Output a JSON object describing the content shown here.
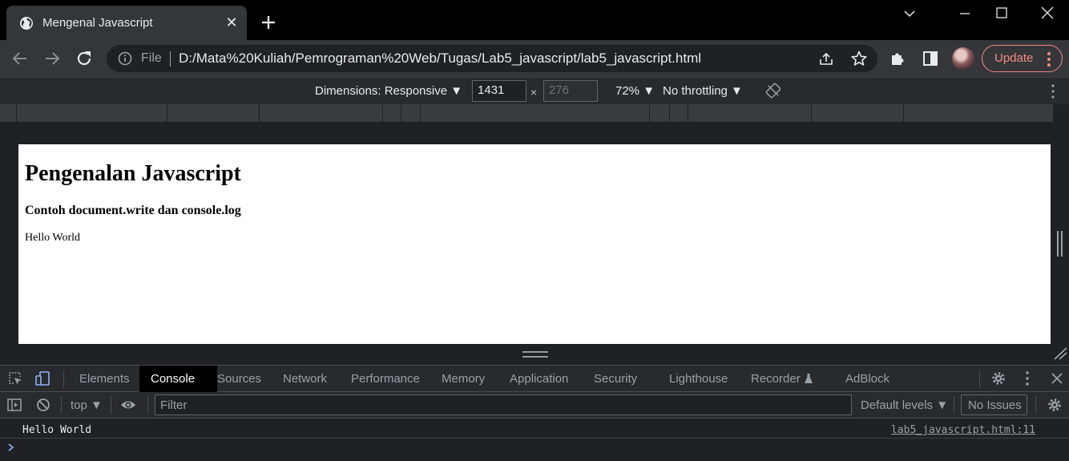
{
  "browser": {
    "tab_title": "Mengenal Javascript",
    "tab_favicon": "globe-icon",
    "new_tab_symbol": "+",
    "close_symbol": "✕",
    "omnibox_scheme_label": "File",
    "url": "D:/Mata%20Kuliah/Pemrograman%20Web/Tugas/Lab5_javascript/lab5_javascript.html",
    "update_label": "Update",
    "accent_color": "#f28b82"
  },
  "device_toolbar": {
    "dimensions_label": "Dimensions: Responsive ▼",
    "width_value": "1431",
    "height_placeholder": "276",
    "times_symbol": "×",
    "zoom_label": "72% ▼",
    "throttling_label": "No throttling ▼"
  },
  "page": {
    "heading": "Pengenalan Javascript",
    "subheading": "Contoh document.write dan console.log",
    "body_text": "Hello World"
  },
  "devtools": {
    "tabs": [
      {
        "label": "Elements",
        "active": false
      },
      {
        "label": "Console",
        "active": true
      },
      {
        "label": "Sources",
        "active": false
      },
      {
        "label": "Network",
        "active": false
      },
      {
        "label": "Performance",
        "active": false
      },
      {
        "label": "Memory",
        "active": false
      },
      {
        "label": "Application",
        "active": false
      },
      {
        "label": "Security",
        "active": false
      },
      {
        "label": "Lighthouse",
        "active": false
      },
      {
        "label": "Recorder",
        "active": false
      },
      {
        "label": "AdBlock",
        "active": false
      }
    ],
    "console_toolbar": {
      "context_label": "top ▼",
      "filter_placeholder": "Filter",
      "levels_label": "Default levels ▼",
      "issues_label": "No Issues"
    },
    "console_messages": [
      {
        "text": "Hello World",
        "source": "lab5_javascript.html:11"
      }
    ],
    "prompt_symbol": "›"
  }
}
